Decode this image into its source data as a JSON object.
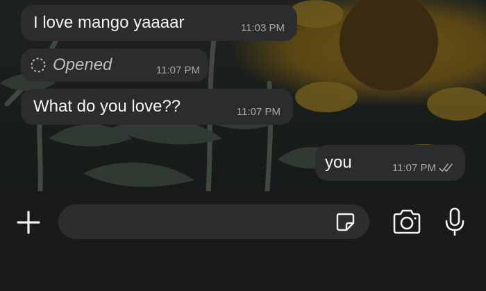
{
  "messages": [
    {
      "text": "I love mango yaaaar",
      "time": "11:03 PM"
    },
    {
      "status": "Opened",
      "time": "11:07 PM"
    },
    {
      "text": "What do you love??",
      "time": "11:07 PM"
    },
    {
      "text": "you",
      "time": "11:07 PM"
    }
  ],
  "icons": {
    "opened": "opened-status-icon",
    "read": "double-check-icon",
    "add": "plus-icon",
    "sticker": "sticker-icon",
    "camera": "camera-icon",
    "mic": "microphone-icon"
  },
  "input": {
    "placeholder": ""
  },
  "colors": {
    "bubble": "#2c2c2e",
    "input": "#2e2e30",
    "bar": "#1a1a1a"
  }
}
